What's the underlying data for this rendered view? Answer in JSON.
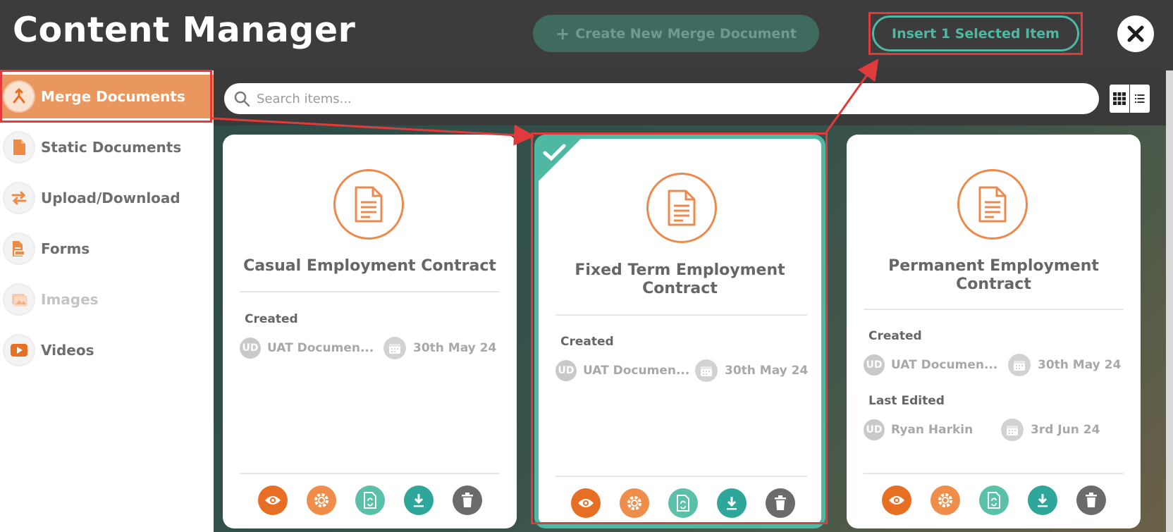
{
  "header": {
    "title": "Content Manager",
    "create_button": "Create New Merge Document",
    "insert_button": "Insert 1 Selected Item",
    "close_icon": "close-icon"
  },
  "sidebar": {
    "items": [
      {
        "label": "Merge Documents",
        "icon": "merge-icon",
        "state": "active"
      },
      {
        "label": "Static Documents",
        "icon": "document-icon",
        "state": "normal"
      },
      {
        "label": "Upload/Download",
        "icon": "transfer-icon",
        "state": "normal"
      },
      {
        "label": "Forms",
        "icon": "form-icon",
        "state": "normal"
      },
      {
        "label": "Images",
        "icon": "image-icon",
        "state": "disabled"
      },
      {
        "label": "Videos",
        "icon": "video-icon",
        "state": "normal"
      }
    ]
  },
  "search": {
    "placeholder": "Search items...",
    "value": ""
  },
  "view_toggle": {
    "grid_icon": "grid-view-icon",
    "list_icon": "list-view-icon",
    "active": "grid"
  },
  "cards": [
    {
      "title": "Casual Employment Contract",
      "selected": false,
      "created_label": "Created",
      "created_initials": "UD",
      "created_by": "UAT Documen...",
      "created_date": "30th May 24"
    },
    {
      "title": "Fixed Term Employment Contract",
      "selected": true,
      "created_label": "Created",
      "created_initials": "UD",
      "created_by": "UAT Documen...",
      "created_date": "30th May 24"
    },
    {
      "title": "Permanent Employment Contract",
      "selected": false,
      "created_label": "Created",
      "created_initials": "UD",
      "created_by": "UAT Documen...",
      "created_date": "30th May 24",
      "edited_label": "Last Edited",
      "edited_initials": "UD",
      "edited_by": "Ryan Harkin",
      "edited_date": "3rd Jun 24"
    }
  ],
  "card_actions": [
    "view-icon",
    "settings-icon",
    "convert-icon",
    "download-icon",
    "delete-icon"
  ],
  "colors": {
    "accent_orange": "#e9975e",
    "accent_teal": "#4fb8a2",
    "annotation_red": "#e03a3a",
    "header_bg": "#3c3c3c"
  }
}
